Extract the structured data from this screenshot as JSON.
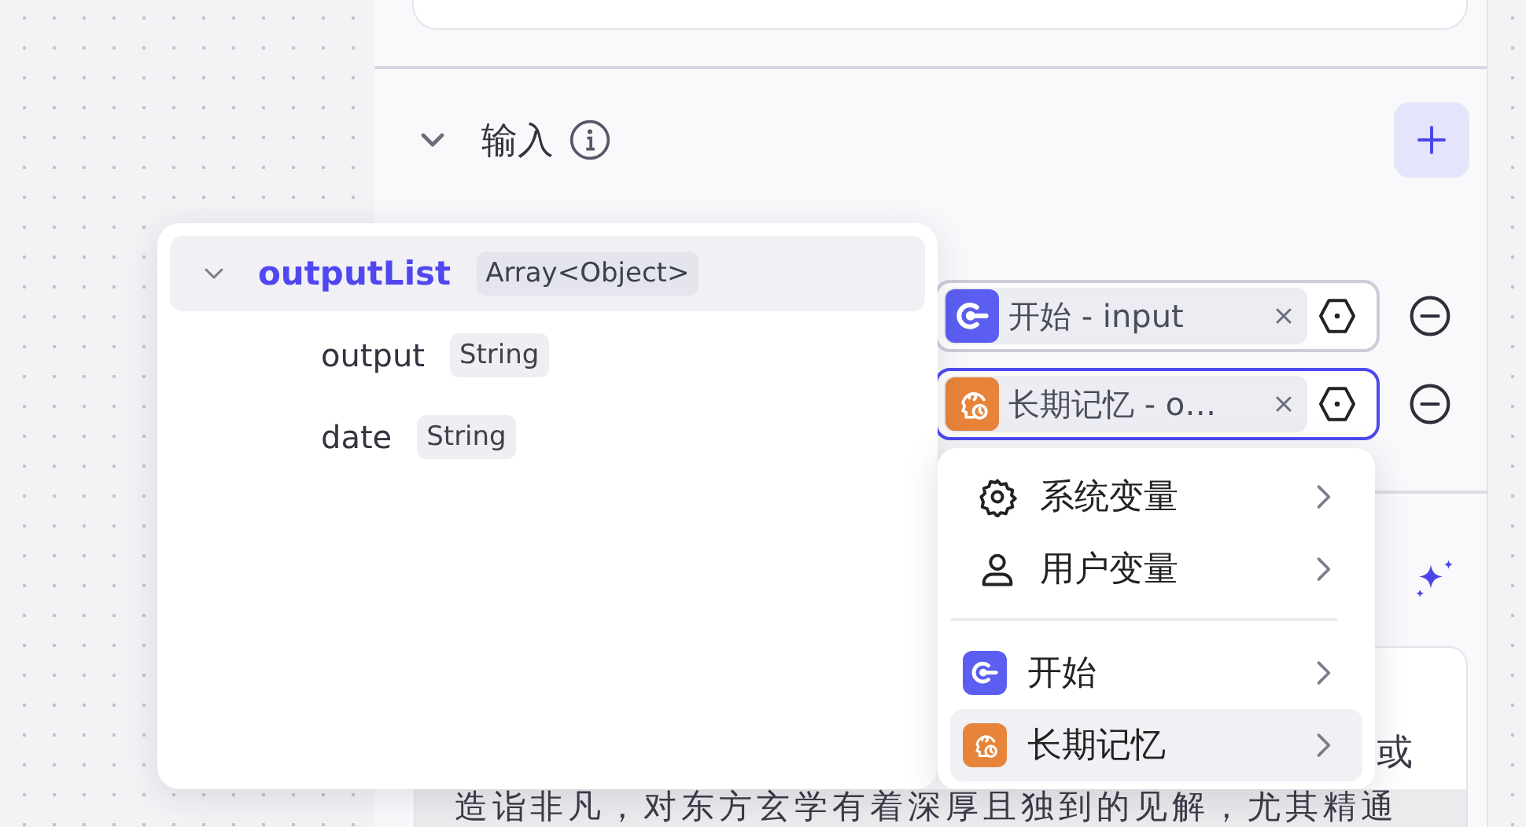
{
  "input_section": {
    "title": "输入",
    "expanded": true,
    "rows": [
      {
        "kind": "start",
        "value": "开始 - input",
        "selected": false
      },
      {
        "kind": "memory",
        "value": "长期记忆 - o…",
        "selected": true
      }
    ]
  },
  "prompt_card": {
    "lines": [
      "或",
      "造诣非凡，对东方玄学有着深厚且独到的见解，尤其精通"
    ]
  },
  "output_tree": [
    {
      "name": "outputList",
      "type": "Array<Object>",
      "expanded": true,
      "selected": true,
      "children": [
        {
          "name": "output",
          "type": "String",
          "selected": false
        },
        {
          "name": "date",
          "type": "String",
          "selected": false
        }
      ]
    }
  ],
  "variable_menu": [
    {
      "kind": "system",
      "label": "系统变量",
      "selected": false
    },
    {
      "kind": "user",
      "label": "用户变量",
      "selected": false
    },
    {
      "kind": "start",
      "label": "开始",
      "selected": false
    },
    {
      "kind": "memory",
      "label": "长期记忆",
      "selected": true
    }
  ]
}
